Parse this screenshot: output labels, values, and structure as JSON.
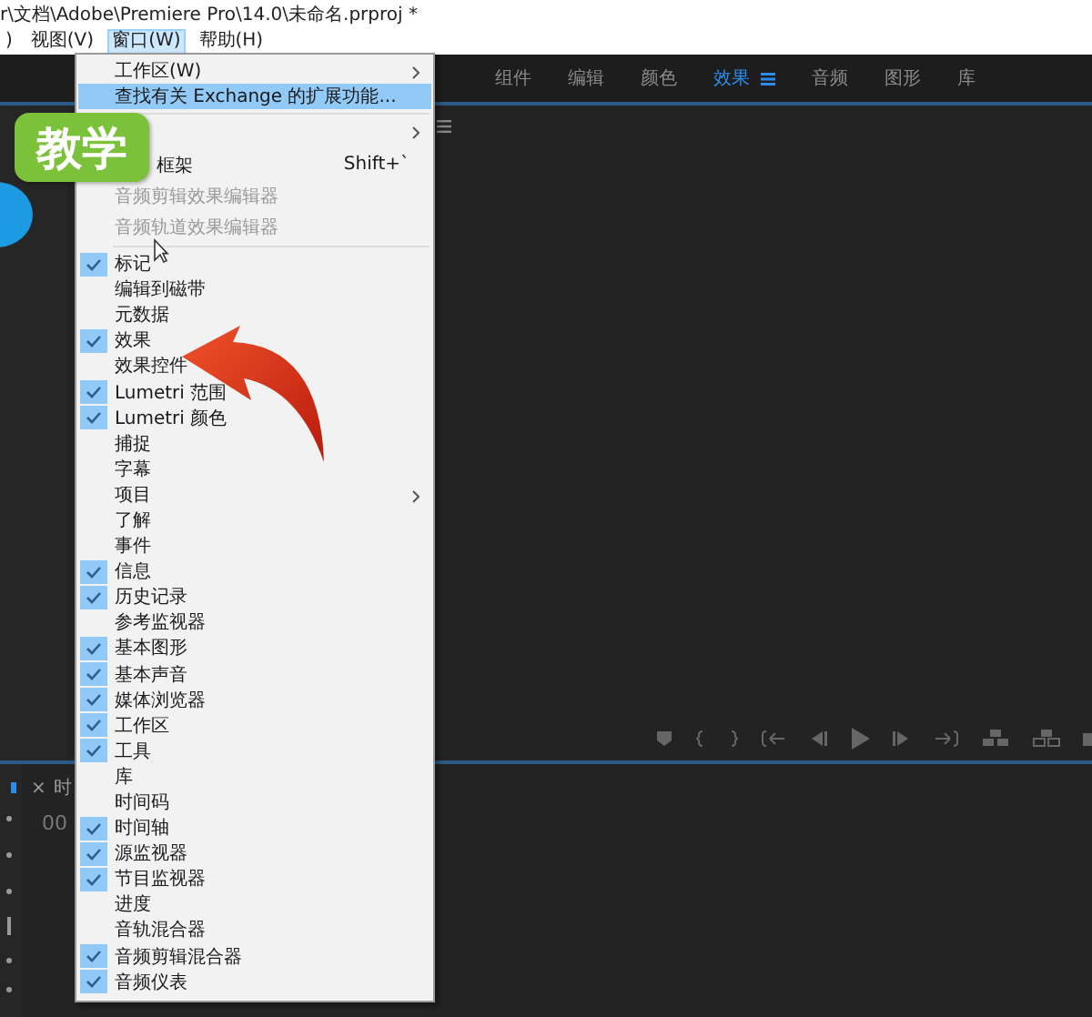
{
  "window": {
    "title": "r\\文档\\Adobe\\Premiere Pro\\14.0\\未命名.prproj *"
  },
  "menu_bar": [
    {
      "label": ")",
      "selected": false
    },
    {
      "label": "视图(V)",
      "selected": false
    },
    {
      "label": "窗口(W)",
      "selected": true
    },
    {
      "label": "帮助(H)",
      "selected": false
    }
  ],
  "workspace_tabs": [
    {
      "label": "组件",
      "selected": false
    },
    {
      "label": "编辑",
      "selected": false
    },
    {
      "label": "颜色",
      "selected": false
    },
    {
      "label": "效果",
      "selected": true
    },
    {
      "label": "音频",
      "selected": false
    },
    {
      "label": "图形",
      "selected": false
    },
    {
      "label": "库",
      "selected": false
    }
  ],
  "bottom_panel": {
    "tab": "时",
    "close": "×",
    "timecode": "00"
  },
  "badge": {
    "label": "教学"
  },
  "window_menu": {
    "sections": [
      [
        {
          "label": "工作区(W)",
          "checked": false,
          "disabled": false,
          "highlighted": false,
          "submenu": true
        },
        {
          "label": "查找有关 Exchange 的扩展功能...",
          "checked": false,
          "disabled": false,
          "highlighted": true,
          "submenu": false
        }
      ],
      [
        {
          "disabled": false,
          "highlighted": false,
          "submenu": true
        },
        {
          "label": "框架",
          "shortcut": "Shift+`",
          "disabled": false,
          "highlighted": false,
          "submenu": false
        },
        {
          "label": "音频剪辑效果编辑器",
          "checked": false,
          "disabled": true,
          "highlighted": false,
          "submenu": false
        },
        {
          "label": "音频轨道效果编辑器",
          "checked": false,
          "disabled": true,
          "highlighted": false,
          "submenu": false
        }
      ],
      [
        {
          "label": "标记",
          "checked": true,
          "disabled": false,
          "highlighted": false,
          "submenu": false
        },
        {
          "label": "编辑到磁带",
          "checked": false,
          "disabled": false,
          "highlighted": false,
          "submenu": false
        },
        {
          "label": "元数据",
          "checked": false,
          "disabled": false,
          "highlighted": false,
          "submenu": false
        },
        {
          "label": "效果",
          "checked": true,
          "disabled": false,
          "highlighted": false,
          "submenu": false
        },
        {
          "label": "效果控件",
          "checked": false,
          "disabled": false,
          "highlighted": false,
          "submenu": false
        },
        {
          "label": "Lumetri 范围",
          "checked": true,
          "disabled": false,
          "highlighted": false,
          "submenu": false
        },
        {
          "label": "Lumetri 颜色",
          "checked": true,
          "disabled": false,
          "highlighted": false,
          "submenu": false
        },
        {
          "label": "捕捉",
          "checked": false,
          "disabled": false,
          "highlighted": false,
          "submenu": false
        },
        {
          "label": "字幕",
          "checked": false,
          "disabled": false,
          "highlighted": false,
          "submenu": false
        },
        {
          "label": "项目",
          "checked": false,
          "disabled": false,
          "highlighted": false,
          "submenu": true
        },
        {
          "label": "了解",
          "checked": false,
          "disabled": false,
          "highlighted": false,
          "submenu": false
        },
        {
          "label": "事件",
          "checked": false,
          "disabled": false,
          "highlighted": false,
          "submenu": false
        },
        {
          "label": "信息",
          "checked": true,
          "disabled": false,
          "highlighted": false,
          "submenu": false
        },
        {
          "label": "历史记录",
          "checked": true,
          "disabled": false,
          "highlighted": false,
          "submenu": false
        },
        {
          "label": "参考监视器",
          "checked": false,
          "disabled": false,
          "highlighted": false,
          "submenu": false
        },
        {
          "label": "基本图形",
          "checked": true,
          "disabled": false,
          "highlighted": false,
          "submenu": false
        },
        {
          "label": "基本声音",
          "checked": true,
          "disabled": false,
          "highlighted": false,
          "submenu": false
        },
        {
          "label": "媒体浏览器",
          "checked": true,
          "disabled": false,
          "highlighted": false,
          "submenu": false
        },
        {
          "label": "工作区",
          "checked": true,
          "disabled": false,
          "highlighted": false,
          "submenu": false
        },
        {
          "label": "工具",
          "checked": true,
          "disabled": false,
          "highlighted": false,
          "submenu": false
        },
        {
          "label": "库",
          "checked": false,
          "disabled": false,
          "highlighted": false,
          "submenu": false
        },
        {
          "label": "时间码",
          "checked": false,
          "disabled": false,
          "highlighted": false,
          "submenu": false
        },
        {
          "label": "时间轴",
          "checked": true,
          "disabled": false,
          "highlighted": false,
          "submenu": false
        },
        {
          "label": "源监视器",
          "checked": true,
          "disabled": false,
          "highlighted": false,
          "submenu": false
        },
        {
          "label": "节目监视器",
          "checked": true,
          "disabled": false,
          "highlighted": false,
          "submenu": false
        },
        {
          "label": "进度",
          "checked": false,
          "disabled": false,
          "highlighted": false,
          "submenu": false
        },
        {
          "label": "音轨混合器",
          "checked": false,
          "disabled": false,
          "highlighted": false,
          "submenu": false
        },
        {
          "label": "音频剪辑混合器",
          "checked": true,
          "disabled": false,
          "highlighted": false,
          "submenu": false
        },
        {
          "label": "音频仪表",
          "checked": true,
          "disabled": false,
          "highlighted": false,
          "submenu": false
        }
      ]
    ]
  }
}
